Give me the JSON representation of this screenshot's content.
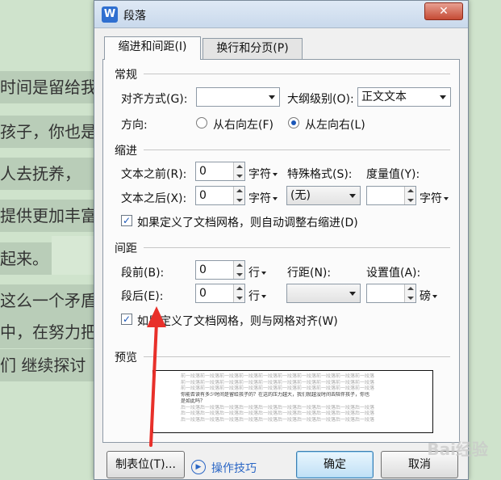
{
  "background_doc": {
    "lines": [
      "时间是留给我",
      "孩子，你也是",
      "人去抚养，",
      "提供更加丰富",
      "起来。",
      "这么一个矛盾",
      "中，在努力把",
      "们 继续探讨"
    ]
  },
  "dialog": {
    "app_icon": "W",
    "title": "段落",
    "close_label": "✕",
    "tabs": [
      {
        "label": "缩进和间距(I)",
        "active": true
      },
      {
        "label": "换行和分页(P)",
        "active": false
      }
    ],
    "general": {
      "section": "常规",
      "alignment_label": "对齐方式(G):",
      "alignment_value": "",
      "outline_label": "大纲级别(O):",
      "outline_value": "正文文本",
      "direction_label": "方向:",
      "rtl_label": "从右向左(F)",
      "ltr_label": "从左向右(L)",
      "direction_selected": "ltr"
    },
    "indent": {
      "section": "缩进",
      "before_label": "文本之前(R):",
      "before_value": "0",
      "before_unit": "字符",
      "after_label": "文本之后(X):",
      "after_value": "0",
      "after_unit": "字符",
      "special_label": "特殊格式(S):",
      "special_value": "(无)",
      "measure_label": "度量值(Y):",
      "measure_value": "",
      "measure_unit": "字符",
      "auto_adjust_label": "如果定义了文档网格，则自动调整右缩进(D)",
      "auto_adjust_checked": true
    },
    "spacing": {
      "section": "间距",
      "before_label": "段前(B):",
      "before_value": "0",
      "before_unit": "行",
      "after_label": "段后(E):",
      "after_value": "0",
      "after_unit": "行",
      "line_label": "行距(N):",
      "line_value": "",
      "setting_label": "设置值(A):",
      "setting_value": "",
      "setting_unit": "磅",
      "grid_align_label": "如果定义了文档网格，则与网格对齐(W)",
      "grid_align_checked": true
    },
    "preview": {
      "section": "预览",
      "prev_lines": [
        "前一段落前一段落前一段落前一段落前一段落前一段落前一段落前一段落前一段落前一段落",
        "前一段落前一段落前一段落前一段落前一段落前一段落前一段落前一段落前一段落前一段落",
        "前一段落前一段落前一段落前一段落前一段落前一段落前一段落前一段落前一段落前一段落"
      ],
      "sample_lines": [
        "你能否读有多少时间是留给孩子的？在这的压力越大，我们就越没时间去陪伴孩子，你也",
        "是如此吗？"
      ],
      "next_lines": [
        "后一段落后一段落后一段落后一段落后一段落后一段落后一段落后一段落后一段落后一段落",
        "后一段落后一段落后一段落后一段落后一段落后一段落后一段落后一段落后一段落后一段落",
        "后一段落后一段落后一段落后一段落后一段落后一段落后一段落后一段落后一段落后一段落"
      ]
    },
    "footer": {
      "tabs_button": "制表位(T)...",
      "tips_link": "操作技巧",
      "ok_button": "确定",
      "cancel_button": "取消"
    }
  },
  "watermark": "Bai经验",
  "colors": {
    "annotation_arrow": "#e8302a",
    "accent_blue": "#2a66c5",
    "dialog_bg": "#f0f0f0"
  }
}
